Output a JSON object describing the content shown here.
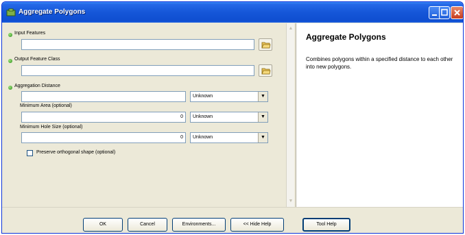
{
  "window": {
    "title": "Aggregate Polygons"
  },
  "form": {
    "input_features": {
      "label": "Input Features",
      "value": ""
    },
    "output_feature_class": {
      "label": "Output Feature Class",
      "value": ""
    },
    "aggregation_distance": {
      "label": "Aggregation Distance",
      "value": "",
      "unit": "Unknown"
    },
    "minimum_area": {
      "label": "Minimum Area (optional)",
      "value": "0",
      "unit": "Unknown"
    },
    "minimum_hole_size": {
      "label": "Minimum Hole Size (optional)",
      "value": "0",
      "unit": "Unknown"
    },
    "preserve_orthogonal": {
      "label": "Preserve orthogonal shape (optional)",
      "checked": false
    }
  },
  "help": {
    "title": "Aggregate Polygons",
    "body": "Combines polygons within a specified distance to each other into new polygons."
  },
  "buttons": {
    "ok": "OK",
    "cancel": "Cancel",
    "environments": "Environments...",
    "hide_help": "<< Hide Help",
    "tool_help": "Tool Help"
  },
  "icons": {
    "title": "toolbox-icon",
    "browse": "open-folder-icon",
    "required": "green-dot-icon"
  },
  "colors": {
    "titlebar": "#0f4ed0",
    "required_dot": "#2d8d1c",
    "window_bg": "#ece9d8"
  }
}
